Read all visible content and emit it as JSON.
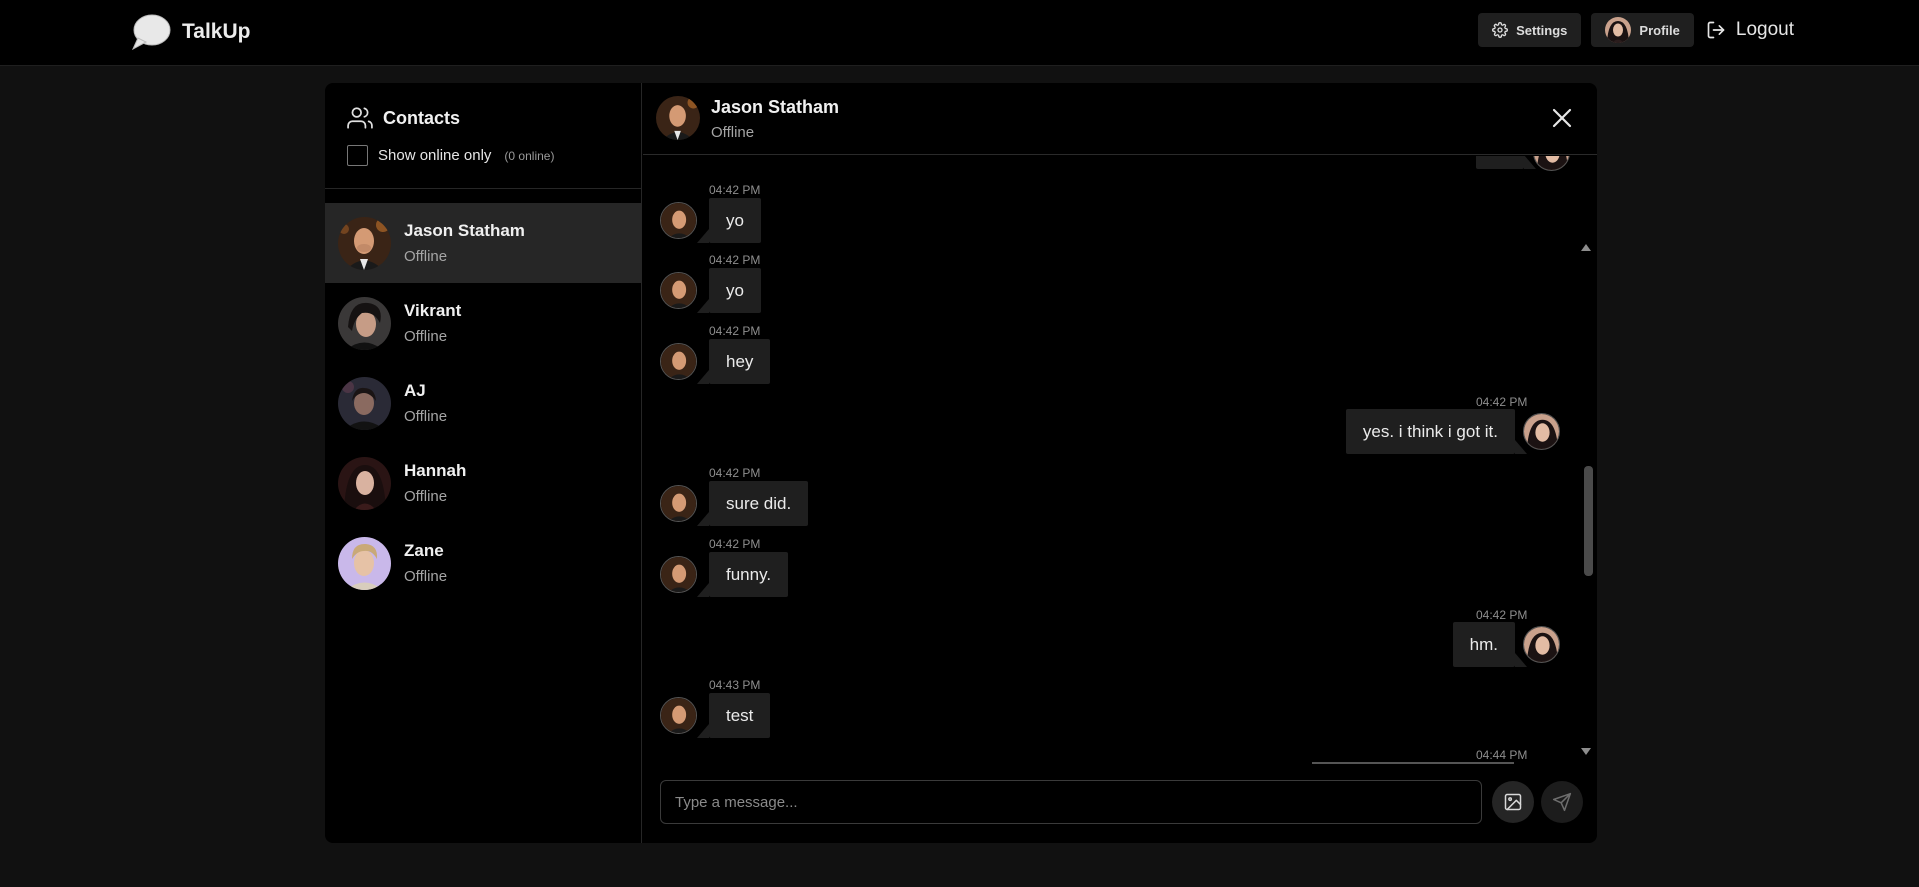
{
  "app": {
    "name": "TalkUp"
  },
  "nav": {
    "settings_label": "Settings",
    "profile_label": "Profile",
    "logout_label": "Logout"
  },
  "sidebar": {
    "title": "Contacts",
    "filter_label": "Show online only",
    "online_count": "(0 online)",
    "contacts": [
      {
        "name": "Jason Statham",
        "status": "Offline"
      },
      {
        "name": "Vikrant",
        "status": "Offline"
      },
      {
        "name": "AJ",
        "status": "Offline"
      },
      {
        "name": "Hannah",
        "status": "Offline"
      },
      {
        "name": "Zane",
        "status": "Offline"
      }
    ]
  },
  "chat": {
    "name": "Jason Statham",
    "status": "Offline",
    "messages": [
      {
        "time": "04:42 PM",
        "text": "yo",
        "from": "them"
      },
      {
        "time": "04:42 PM",
        "text": "yo",
        "from": "them"
      },
      {
        "time": "04:42 PM",
        "text": "hey",
        "from": "them"
      },
      {
        "time": "04:42 PM",
        "text": "yes. i think i got it.",
        "from": "me"
      },
      {
        "time": "04:42 PM",
        "text": "sure did.",
        "from": "them"
      },
      {
        "time": "04:42 PM",
        "text": "funny.",
        "from": "them"
      },
      {
        "time": "04:42 PM",
        "text": "hm.",
        "from": "me"
      },
      {
        "time": "04:43 PM",
        "text": "test",
        "from": "them"
      },
      {
        "time": "04:44 PM",
        "text": "",
        "from": "me"
      }
    ]
  },
  "composer": {
    "placeholder": "Type a message..."
  },
  "icons": {
    "brand": "chat-bubble-icon",
    "settings": "gear-icon",
    "logout": "logout-icon",
    "contacts": "users-icon",
    "close": "close-icon",
    "image": "image-icon",
    "send": "send-icon"
  },
  "colors": {
    "background": "#111111",
    "panel": "#000000",
    "bubble": "#1f1f1f",
    "active_contact": "#262626"
  }
}
